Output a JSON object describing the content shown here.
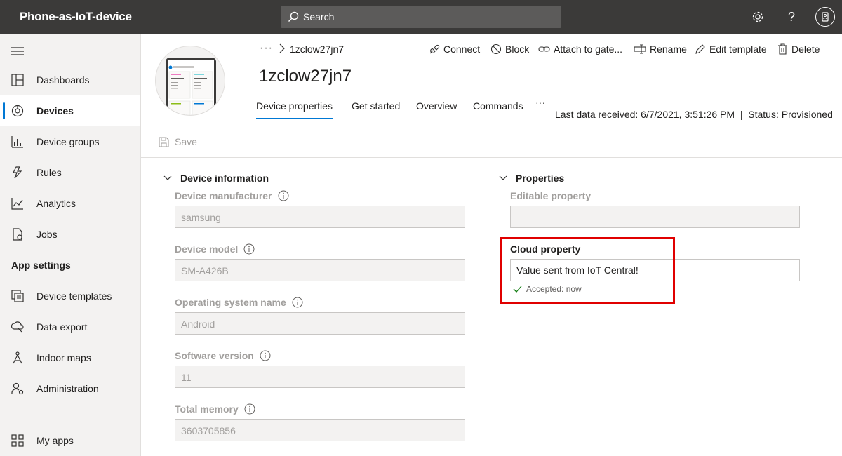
{
  "topbar": {
    "app_title": "Phone-as-IoT-device",
    "search_placeholder": "Search",
    "icons": [
      "gear-icon",
      "help-icon",
      "account-icon"
    ]
  },
  "sidebar": {
    "items": [
      {
        "label": "Dashboards",
        "icon": "dashboard-icon",
        "active": false
      },
      {
        "label": "Devices",
        "icon": "devices-icon",
        "active": true
      },
      {
        "label": "Device groups",
        "icon": "device-groups-icon",
        "active": false
      },
      {
        "label": "Rules",
        "icon": "rules-icon",
        "active": false
      },
      {
        "label": "Analytics",
        "icon": "analytics-icon",
        "active": false
      },
      {
        "label": "Jobs",
        "icon": "jobs-icon",
        "active": false
      }
    ],
    "section_label": "App settings",
    "settings_items": [
      {
        "label": "Device templates",
        "icon": "device-templates-icon"
      },
      {
        "label": "Data export",
        "icon": "data-export-icon"
      },
      {
        "label": "Indoor maps",
        "icon": "indoor-maps-icon"
      },
      {
        "label": "Administration",
        "icon": "administration-icon"
      }
    ],
    "footer_item": {
      "label": "My apps",
      "icon": "my-apps-icon"
    }
  },
  "header": {
    "breadcrumb_more": "···",
    "breadcrumb_name": "1zclow27jn7",
    "title": "1zclow27jn7",
    "actions": [
      {
        "label": "Connect",
        "icon": "connect-icon"
      },
      {
        "label": "Block",
        "icon": "block-icon"
      },
      {
        "label": "Attach to gate...",
        "icon": "attach-icon"
      },
      {
        "label": "Rename",
        "icon": "rename-icon"
      },
      {
        "label": "Edit template",
        "icon": "edit-icon"
      },
      {
        "label": "Delete",
        "icon": "delete-icon"
      }
    ],
    "tabs": [
      {
        "label": "Device properties",
        "active": true
      },
      {
        "label": "Get started",
        "active": false
      },
      {
        "label": "Overview",
        "active": false
      },
      {
        "label": "Commands",
        "active": false
      }
    ],
    "tabs_more": "···",
    "status_line": "Last data received: 6/7/2021, 3:51:26 PM  |  Status: Provisioned"
  },
  "toolbar": {
    "save_label": "Save"
  },
  "device_information": {
    "heading": "Device information",
    "fields": [
      {
        "label": "Device manufacturer",
        "value": "samsung"
      },
      {
        "label": "Device model",
        "value": "SM-A426B"
      },
      {
        "label": "Operating system name",
        "value": "Android"
      },
      {
        "label": "Software version",
        "value": "11"
      },
      {
        "label": "Total memory",
        "value": "3603705856"
      }
    ]
  },
  "properties": {
    "heading": "Properties",
    "editable_label": "Editable property",
    "editable_value": "",
    "cloud_label": "Cloud property",
    "cloud_value": "Value sent from IoT Central!",
    "accepted_text": "Accepted: now"
  },
  "colors": {
    "topbar": "#3b3a39",
    "accent": "#0078d4",
    "highlight": "#e00000",
    "success": "#107c10"
  }
}
